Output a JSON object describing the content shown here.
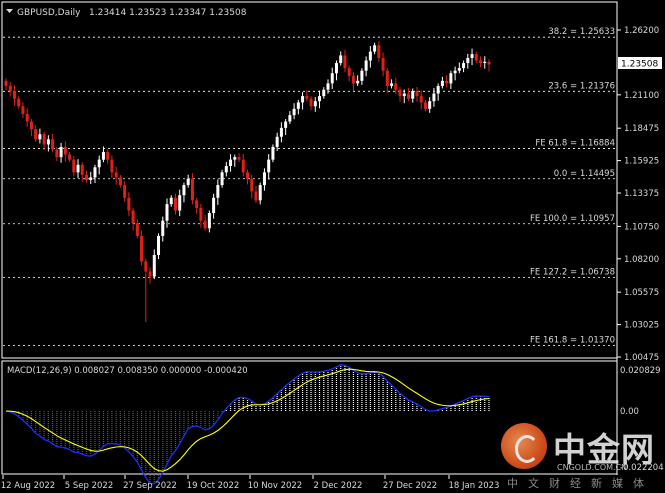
{
  "window": {
    "symbol_label": "GBPUSD,Daily",
    "ohlc": "1.23414 1.23523 1.23347 1.23508",
    "current_price": "1.23508"
  },
  "price_axis": [
    "1.26200",
    "1.23508",
    "1.21100",
    "1.18475",
    "1.15925",
    "1.13375",
    "1.10750",
    "1.08200",
    "1.05575",
    "1.03025",
    "1.00475"
  ],
  "fib_levels": [
    {
      "label": "38.2 = 1.25633",
      "value": 1.25633
    },
    {
      "label": "23.6 = 1.21376",
      "value": 1.21376
    },
    {
      "label": "FE 61.8 = 1.16884",
      "value": 1.16884
    },
    {
      "label": "0.0 = 1.14495",
      "value": 1.14495
    },
    {
      "label": "FE 100.0 = 1.10957",
      "value": 1.10957
    },
    {
      "label": "FE 127.2 = 1.06738",
      "value": 1.06738
    },
    {
      "label": "FE 161.8 = 1.01370",
      "value": 1.0137
    }
  ],
  "macd": {
    "label": "MACD(12,26,9) 0.008027 0.008350 0.000000 -0.000420",
    "axis": [
      "0.020829",
      "0.00",
      "-0.022204"
    ]
  },
  "time_axis": [
    "12 Aug 2022",
    "5 Sep 2022",
    "27 Sep 2022",
    "19 Oct 2022",
    "10 Nov 2022",
    "2 Dec 2022",
    "27 Dec 2022",
    "18 Jan 2023"
  ],
  "colors": {
    "bull": "#ffffff",
    "bear": "#e0201a",
    "grid": "#ffffff",
    "text": "#d8d8d8",
    "signal": "#ffff00",
    "macd_line": "#1c2cff",
    "hist_pos": "#ffffff",
    "hist_neg": "#e0201a"
  },
  "watermark": {
    "cn": "中金网",
    "url": "CNGOLD.COM.CN",
    "sub": "中文财经新媒体"
  },
  "chart_data": {
    "type": "candlestick",
    "symbol": "GBPUSD",
    "timeframe": "Daily",
    "ylim": [
      1.0047,
      1.262
    ],
    "closes": [
      1.218,
      1.214,
      1.208,
      1.202,
      1.196,
      1.19,
      1.184,
      1.176,
      1.18,
      1.172,
      1.176,
      1.168,
      1.162,
      1.17,
      1.164,
      1.16,
      1.15,
      1.156,
      1.148,
      1.144,
      1.146,
      1.154,
      1.16,
      1.166,
      1.16,
      1.15,
      1.146,
      1.14,
      1.13,
      1.12,
      1.11,
      1.1,
      1.08,
      1.072,
      1.068,
      1.085,
      1.1,
      1.112,
      1.125,
      1.13,
      1.12,
      1.132,
      1.14,
      1.145,
      1.128,
      1.122,
      1.112,
      1.106,
      1.118,
      1.13,
      1.14,
      1.15,
      1.155,
      1.16,
      1.162,
      1.16,
      1.15,
      1.145,
      1.135,
      1.128,
      1.14,
      1.15,
      1.16,
      1.17,
      1.178,
      1.185,
      1.19,
      1.195,
      1.2,
      1.205,
      1.21,
      1.208,
      1.202,
      1.206,
      1.21,
      1.215,
      1.22,
      1.228,
      1.236,
      1.242,
      1.232,
      1.226,
      1.22,
      1.222,
      1.23,
      1.238,
      1.245,
      1.25,
      1.24,
      1.23,
      1.218,
      1.22,
      1.215,
      1.21,
      1.212,
      1.208,
      1.214,
      1.21,
      1.205,
      1.2,
      1.206,
      1.212,
      1.218,
      1.222,
      1.22,
      1.228,
      1.23,
      1.232,
      1.236,
      1.24,
      1.243,
      1.238,
      1.236,
      1.237,
      1.235
    ]
  }
}
